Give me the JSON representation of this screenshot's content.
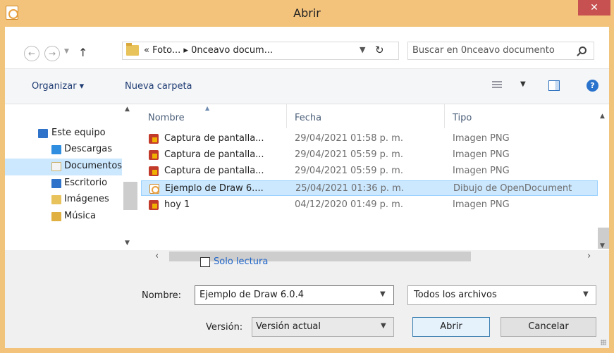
{
  "window": {
    "title": "Abrir",
    "close": "✕"
  },
  "address": {
    "back": "←",
    "forward": "→",
    "up": "↑",
    "path": "« Foto... ▸ 0nceavo docum...",
    "refresh": "↻",
    "search_placeholder": "Buscar en 0nceavo documento"
  },
  "toolbar": {
    "organize": "Organizar ▾",
    "new_folder": "Nueva carpeta",
    "help": "?"
  },
  "nav": {
    "items": [
      {
        "label": "Este equipo"
      },
      {
        "label": "Descargas"
      },
      {
        "label": "Documentos"
      },
      {
        "label": "Escritorio"
      },
      {
        "label": "Imágenes"
      },
      {
        "label": "Música"
      }
    ]
  },
  "files": {
    "columns": [
      "Nombre",
      "Fecha",
      "Tipo"
    ],
    "rows": [
      {
        "name": "Captura de pantalla...",
        "date": "29/04/2021 01:58 p. m.",
        "type": "Imagen PNG"
      },
      {
        "name": "Captura de pantalla...",
        "date": "29/04/2021 05:59 p. m.",
        "type": "Imagen PNG"
      },
      {
        "name": "Captura de pantalla...",
        "date": "29/04/2021 05:59 p. m.",
        "type": "Imagen PNG"
      },
      {
        "name": "Ejemplo de Draw 6....",
        "date": "25/04/2021 01:36 p. m.",
        "type": "Dibujo de OpenDocument"
      },
      {
        "name": "hoy 1",
        "date": "04/12/2020 01:49 p. m.",
        "type": "Imagen PNG"
      }
    ]
  },
  "options": {
    "readonly": "Solo lectura"
  },
  "bottom": {
    "name_label": "Nombre:",
    "name_value": "Ejemplo de Draw 6.0.4",
    "filter": "Todos los archivos",
    "version_label": "Versión:",
    "version_value": "Versión actual",
    "open": "Abrir",
    "cancel": "Cancelar"
  }
}
